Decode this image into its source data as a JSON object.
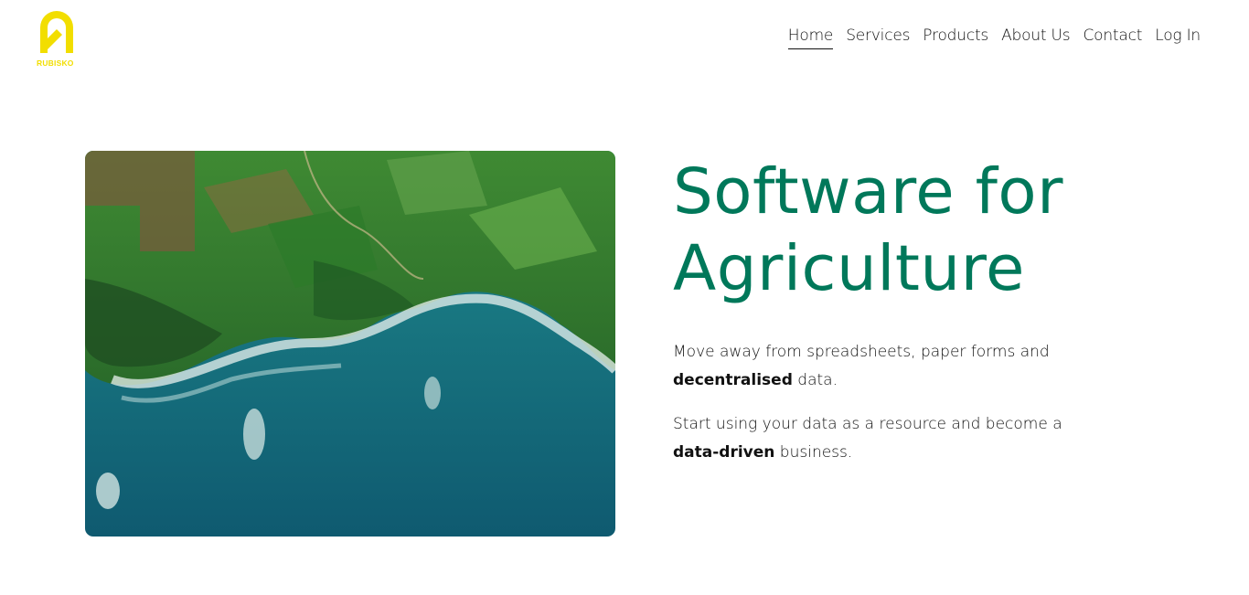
{
  "brand": {
    "name": "RUBISKO",
    "color": "#f2de00"
  },
  "nav": {
    "items": [
      {
        "label": "Home",
        "active": true
      },
      {
        "label": "Services"
      },
      {
        "label": "Products"
      },
      {
        "label": "About Us"
      },
      {
        "label": "Contact"
      },
      {
        "label": "Log In"
      }
    ]
  },
  "hero": {
    "title_line1": "Software for",
    "title_line2": "Agriculture",
    "title_color": "#00785a",
    "para1": {
      "text": "Move away from spreadsheets, paper forms and",
      "bold": "decentralised",
      "tail": "data."
    },
    "para2": {
      "text": "Start using your data as a resource and become a",
      "bold": "data-driven",
      "tail": "business."
    }
  }
}
